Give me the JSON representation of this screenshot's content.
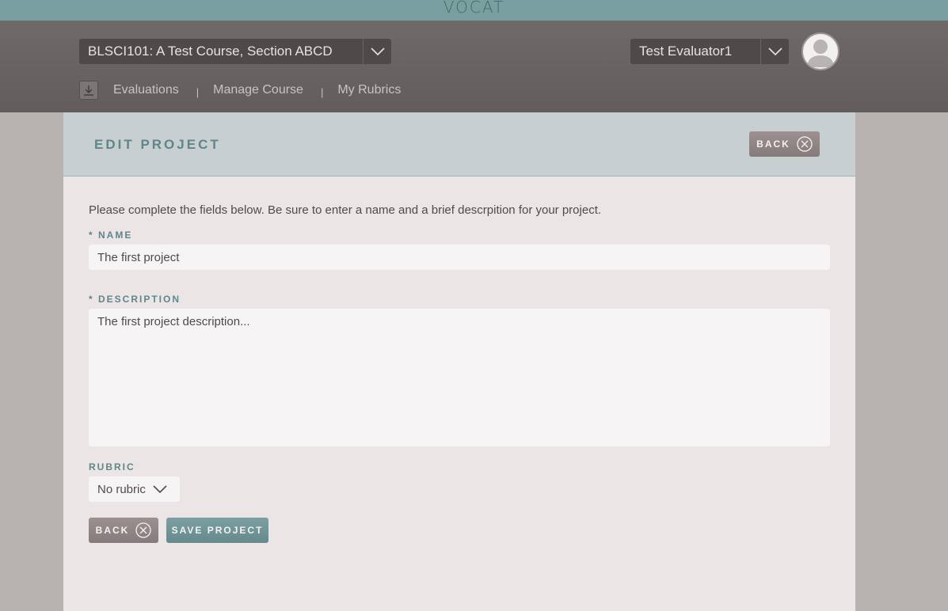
{
  "app": {
    "logo": "VOCAT"
  },
  "header": {
    "course_select": {
      "value": "BLSCI101: A Test Course, Section ABCD"
    },
    "user_select": {
      "value": "Test Evaluator1"
    },
    "nav": {
      "items": [
        {
          "label": "Evaluations"
        },
        {
          "label": "Manage Course"
        },
        {
          "label": "My Rubrics"
        }
      ],
      "separator": "|"
    }
  },
  "page": {
    "title": "EDIT PROJECT",
    "back_label": "BACK",
    "intro": "Please complete the fields below. Be sure to enter a name and a brief descrpition for your project.",
    "name_field": {
      "label": "* NAME",
      "value": "The first project"
    },
    "description_field": {
      "label": "* DESCRIPTION",
      "value": "The first project description..."
    },
    "rubric_field": {
      "label": "RUBRIC",
      "value": "No rubric"
    },
    "footer": {
      "back_label": "BACK",
      "save_label": "SAVE PROJECT"
    }
  },
  "colors": {
    "topbar": "#7a9fa0",
    "header": "#6a6564",
    "accent_teal": "#5f8688",
    "back_button": "#918685",
    "save_button": "#7194966"
  },
  "icons": {
    "nav": "download-icon",
    "dropdown": "chevron-down-icon",
    "back": "close-circle-icon",
    "avatar": "user-avatar-icon"
  }
}
